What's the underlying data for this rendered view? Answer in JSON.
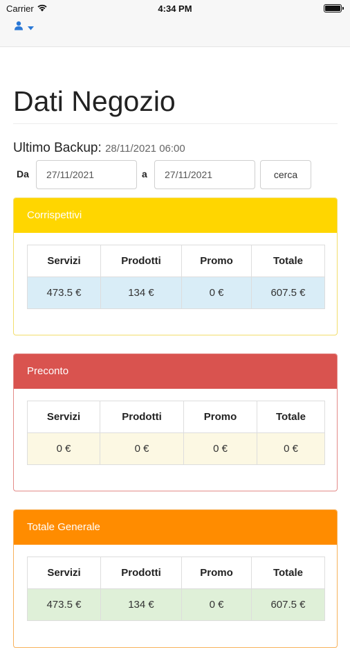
{
  "status_bar": {
    "carrier": "Carrier",
    "time": "4:34 PM"
  },
  "navbar": {
    "user_icon": "user-icon",
    "dropdown_icon": "caret-down-icon"
  },
  "page": {
    "title": "Dati Negozio",
    "backup_label": "Ultimo Backup:",
    "backup_value": "28/11/2021 06:00"
  },
  "filter": {
    "from_label": "Da",
    "from_value": "27/11/2021",
    "to_label": "a",
    "to_value": "27/11/2021",
    "search_label": "cerca"
  },
  "panels": {
    "corrispettivi": {
      "title": "Corrispettivi",
      "headers": [
        "Servizi",
        "Prodotti",
        "Promo",
        "Totale"
      ],
      "row": [
        "473.5 €",
        "134 €",
        "0 €",
        "607.5 €"
      ]
    },
    "preconto": {
      "title": "Preconto",
      "headers": [
        "Servizi",
        "Prodotti",
        "Promo",
        "Totale"
      ],
      "row": [
        "0 €",
        "0 €",
        "0 €",
        "0 €"
      ]
    },
    "totale_generale": {
      "title": "Totale Generale",
      "headers": [
        "Servizi",
        "Prodotti",
        "Promo",
        "Totale"
      ],
      "row": [
        "473.5 €",
        "134 €",
        "0 €",
        "607.5 €"
      ]
    }
  },
  "colors": {
    "corrispettivi_header": "#ffd600",
    "preconto_header": "#d9534f",
    "totale_header": "#ff8c00",
    "user_icon": "#2a78d6"
  }
}
